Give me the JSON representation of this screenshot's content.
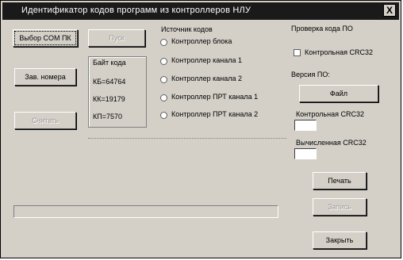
{
  "window": {
    "title": "Идентификатор кодов программ из контроллеров НЛУ",
    "close_glyph": "X"
  },
  "left_buttons": {
    "select_com": "Выбор COM ПК",
    "factory_numbers": "Зав. номера",
    "disabled_button": "Считать"
  },
  "top_disabled_button": "Пуск",
  "code_byte": {
    "header": "Байт кода",
    "kb": "КБ=64764",
    "kk": "КК=19179",
    "kp": "КП=7570"
  },
  "source": {
    "header": "Источник кодов",
    "options": [
      "Контроллер блока",
      "Контроллер канала 1",
      "Контроллер канала 2",
      "Контроллер ПРТ канала 1",
      "Контроллер ПРТ канала 2"
    ]
  },
  "check": {
    "header": "Проверка кода ПО",
    "checkbox_label": "Контрольная CRC32",
    "version_label": "Версия ПО:",
    "file_button": "Файл",
    "control_crc_label": "Контрольная CRC32",
    "control_crc_value": "",
    "computed_crc_label": "Вычисленная CRC32",
    "computed_crc_value": ""
  },
  "actions": {
    "print": "Печать",
    "disabled": "Запись",
    "close": "Закрыть"
  },
  "progress": 0
}
